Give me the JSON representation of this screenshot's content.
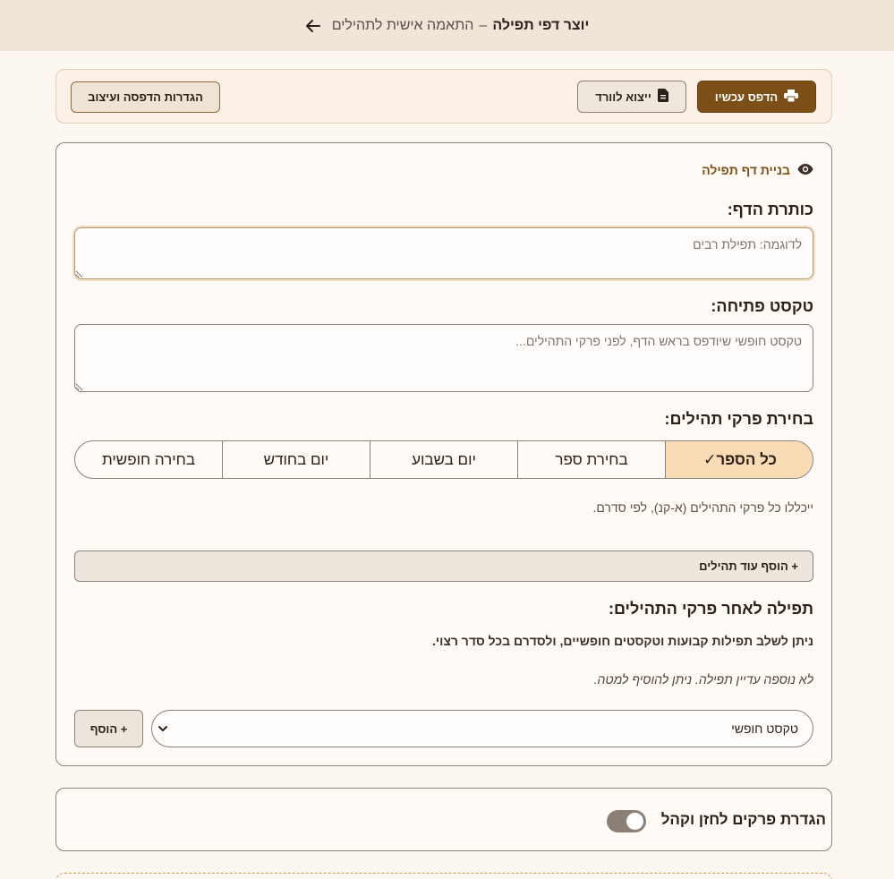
{
  "header": {
    "title": "יוצר דפי תפילה",
    "separator": "–",
    "subtitle": "התאמה אישית לתהילים",
    "back_icon": "arrow-left-icon"
  },
  "toolbar": {
    "print_label": "הדפס עכשיו",
    "print_icon": "printer-icon",
    "export_label": "ייצוא לוורד",
    "export_icon": "document-icon",
    "settings_label": "הגדרות הדפסה ועיצוב"
  },
  "builder": {
    "heading": "בניית דף תפילה",
    "heading_icon": "eye-icon",
    "title_label": "כותרת הדף:",
    "title_placeholder": "לדוגמה: תפילת רבים",
    "title_value": "",
    "intro_label": "טקסט פתיחה:",
    "intro_placeholder": "טקסט חופשי שיודפס בראש הדף, לפני פרקי התהילים...",
    "intro_value": "",
    "chapters_label": "בחירת פרקי תהילים:",
    "modes": [
      {
        "label": "כל הספר",
        "check": "✓",
        "active": true
      },
      {
        "label": "בחירת ספר",
        "active": false
      },
      {
        "label": "יום בשבוע",
        "active": false
      },
      {
        "label": "יום בחודש",
        "active": false
      },
      {
        "label": "בחירה חופשית",
        "active": false
      }
    ],
    "mode_hint": "ייכללו כל פרקי התהילים (א-קנ), לפי סדרם.",
    "add_more_label": "+ הוסף עוד תהילים",
    "after_label": "תפילה לאחר פרקי התהילים:",
    "after_desc": "ניתן לשלב תפילות קבועות וטקסטים חופשיים, ולסדרם בכל סדר רצוי.",
    "empty_note": "לא נוספה עדיין תפילה. ניתן להוסיף למטה.",
    "select_value": "טקסט חופשי",
    "add_label": "+ הוסף"
  },
  "cantor": {
    "label": "הגדרת פרקים לחזן וקהל",
    "toggle_on": false
  },
  "colors": {
    "brand": "#7b4f17",
    "active_segment": "#f9dcb6",
    "background": "#fdf7f2",
    "header_bg": "#efe5d8"
  }
}
